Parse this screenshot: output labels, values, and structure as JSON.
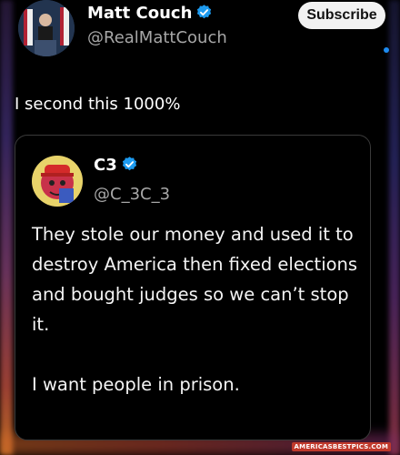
{
  "post": {
    "author_name": "Matt Couch",
    "author_handle": "@RealMattCouch",
    "subscribe_label": "Subscribe",
    "text": "I second this 1000%"
  },
  "quote": {
    "author_name": "C3",
    "author_handle": "@C_3C_3",
    "paragraph1": "They stole our money and used it to destroy America then fixed elections and bought judges so we can’t stop it.",
    "paragraph2": "I want people in prison."
  },
  "watermark": "AMERICASBESTPICS.COM",
  "icons": {
    "verified": "verified-badge-icon"
  },
  "colors": {
    "background": "#000000",
    "verified": "#1d9bf0",
    "handle": "#a7a7a7",
    "subscribe_bg": "#f2f2f2"
  }
}
